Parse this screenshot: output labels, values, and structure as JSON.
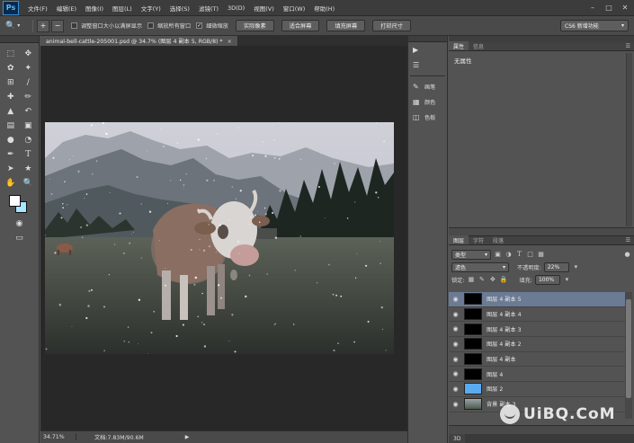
{
  "app": {
    "logo": "Ps"
  },
  "menu": [
    "文件(F)",
    "编辑(E)",
    "图像(I)",
    "图层(L)",
    "文字(Y)",
    "选择(S)",
    "滤镜(T)",
    "3D(D)",
    "视图(V)",
    "窗口(W)",
    "帮助(H)"
  ],
  "options_bar": {
    "checkboxes": [
      {
        "label": "调整窗口大小以满屏显示",
        "checked": false
      },
      {
        "label": "缩放所有窗口",
        "checked": false
      },
      {
        "label": "细微缩放",
        "checked": true
      }
    ],
    "buttons": [
      "实际像素",
      "适合屏幕",
      "填充屏幕",
      "打印尺寸"
    ],
    "workspace": "CS6 新增功能"
  },
  "document": {
    "tab_title": "animal-bell-cattle-205001.psd @ 34.7% (图层 4 副本 5, RGB/8) *",
    "close": "×"
  },
  "status": {
    "zoom": "34.71%",
    "doc": "文档:7.83M/90.6M"
  },
  "colors": {
    "foreground": "#ffffff",
    "background": "#a9e6ff"
  },
  "mid_panel": {
    "items": [
      {
        "icon": "play-icon",
        "label": ""
      },
      {
        "icon": "adjustment-icon",
        "label": ""
      },
      {
        "icon": "brush-preset-icon",
        "label": "画笔"
      },
      {
        "icon": "swatch-grid-icon",
        "label": "颜色"
      },
      {
        "icon": "styles-icon",
        "label": "色板"
      }
    ]
  },
  "properties": {
    "tabs": [
      "属性",
      "信息"
    ],
    "content": "无属性"
  },
  "layers_panel": {
    "tabs": [
      "图层",
      "字符",
      "段落"
    ],
    "filter_kind": "类型",
    "blend_mode": "滤色",
    "opacity_label": "不透明度:",
    "opacity": "22%",
    "lock_label": "锁定:",
    "fill_label": "填充:",
    "fill": "100%",
    "layers": [
      {
        "name": "图层 4 副本 5",
        "thumb": "#000000",
        "selected": true
      },
      {
        "name": "图层 4 副本 4",
        "thumb": "#000000",
        "selected": false
      },
      {
        "name": "图层 4 副本 3",
        "thumb": "#000000",
        "selected": false
      },
      {
        "name": "图层 4 副本 2",
        "thumb": "#000000",
        "selected": false
      },
      {
        "name": "图层 4 副本",
        "thumb": "#000000",
        "selected": false
      },
      {
        "name": "图层 4",
        "thumb": "#000000",
        "selected": false
      },
      {
        "name": "图层 2",
        "thumb": "#5aaaf2",
        "selected": false
      },
      {
        "name": "背景 副本 3",
        "thumb": "#6d7a6a",
        "selected": false
      }
    ],
    "bottom_tab": "3D"
  },
  "watermark": "UiBQ.CoM"
}
